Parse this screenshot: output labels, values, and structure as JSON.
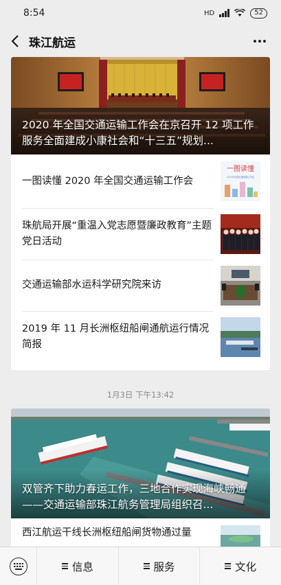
{
  "status": {
    "time": "8:54",
    "signal_label": "HD",
    "battery": "52"
  },
  "nav": {
    "title": "珠江航运"
  },
  "card1": {
    "hero_title": "2020 年全国交通运输工作会在京召开 12 项工作服务全面建成小康社会和“十三五”规划...",
    "items": [
      {
        "text": "一图读懂 2020 年全国交通运输工作会"
      },
      {
        "text": "珠航局开展“重温入党志愿暨廉政教育”主题党日活动"
      },
      {
        "text": "交通运输部水运科学研究院来访"
      },
      {
        "text": "2019 年 11 月长洲枢纽船闸通航运行情况简报"
      }
    ]
  },
  "thumb1": {
    "heading": "一图读懂",
    "sub": "2020年全国交通运输工作会"
  },
  "timestamp": "1月3日 下午13:42",
  "card2": {
    "hero_title": "双管齐下助力春运工作，三地合作实现海峡畅通——交通运输部珠江航务管理局组织召...",
    "items": [
      {
        "text": "西江航运干线长洲枢纽船闸货物通过量"
      }
    ]
  },
  "menu": {
    "items": [
      "信息",
      "服务",
      "文化"
    ]
  },
  "colors": {
    "background": "#ededed",
    "card": "#ffffff",
    "text": "#1a1a1a",
    "muted": "#8a8a8a"
  }
}
